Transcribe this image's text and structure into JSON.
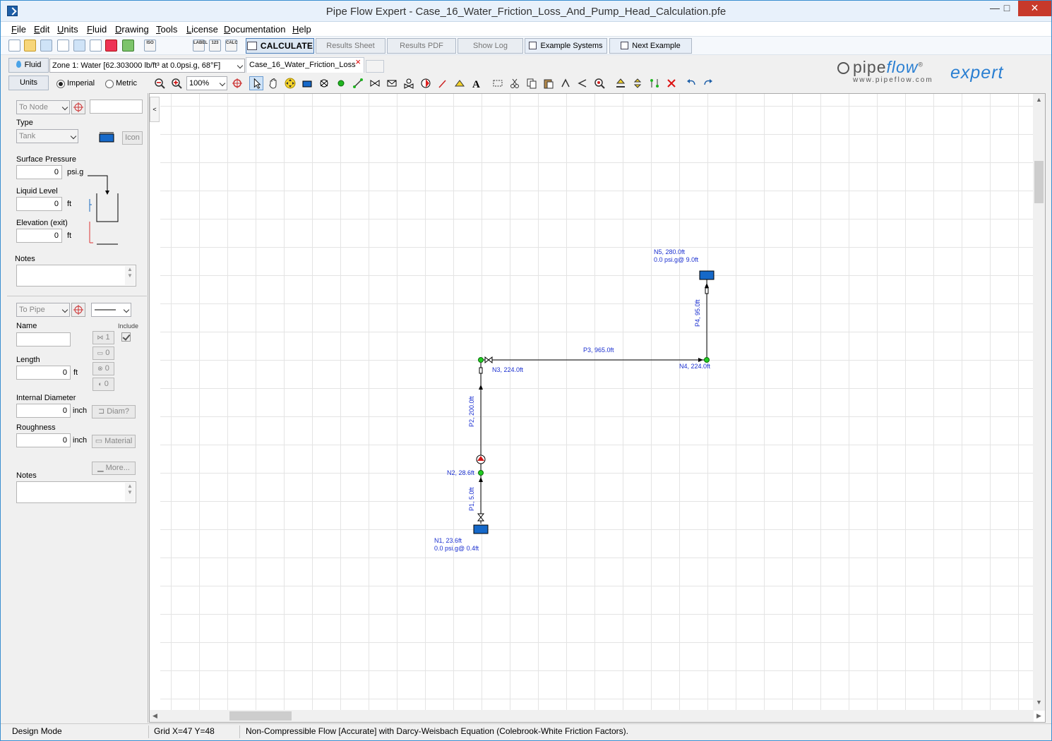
{
  "window": {
    "title": "Pipe Flow Expert - Case_16_Water_Friction_Loss_And_Pump_Head_Calculation.pfe",
    "minimize": "—",
    "maximize": "□",
    "close": "✕"
  },
  "menu": [
    "File",
    "Edit",
    "Units",
    "Fluid",
    "Drawing",
    "Tools",
    "License",
    "Documentation",
    "Help"
  ],
  "toolbar": {
    "calculate": "CALCULATE",
    "results_sheet": "Results Sheet",
    "results_pdf": "Results PDF",
    "show_log": "Show Log",
    "example_systems": "Example Systems",
    "next_example": "Next Example",
    "small_icon_texts": [
      "ISO",
      "LABEL",
      "123",
      "CALC"
    ]
  },
  "fluid_row": {
    "fluid_button": "Fluid",
    "zone": "Zone 1: Water [62.303000 lb/ft³ at 0.0psi.g, 68°F]",
    "tab_name": "Case_16_Water_Friction_Loss",
    "tab_close": "×"
  },
  "units_row": {
    "units_button": "Units",
    "imperial": "Imperial",
    "metric": "Metric",
    "zoom": "100%"
  },
  "logo": {
    "pipe": "pipe",
    "flow": "flow",
    "registered": "®",
    "expert": "expert",
    "url": "www.pipeflow.com"
  },
  "node_panel": {
    "selector": "To Node",
    "type_label": "Type",
    "type_value": "Tank",
    "icon_button": "Icon",
    "surface_pressure_label": "Surface Pressure",
    "surface_pressure_value": "0",
    "surface_pressure_unit": "psi.g",
    "liquid_level_label": "Liquid Level",
    "liquid_level_value": "0",
    "liquid_level_unit": "ft",
    "elevation_label": "Elevation (exit)",
    "elevation_value": "0",
    "elevation_unit": "ft",
    "notes_label": "Notes"
  },
  "pipe_panel": {
    "selector": "To Pipe",
    "name_label": "Name",
    "include_label": "Include",
    "fittings_count": "1",
    "component_count": "0",
    "control_count": "0",
    "pump_count": "0",
    "length_label": "Length",
    "length_value": "0",
    "length_unit": "ft",
    "diameter_label": "Internal Diameter",
    "diameter_value": "0",
    "diameter_unit": "inch",
    "diameter_button": "Diam?",
    "roughness_label": "Roughness",
    "roughness_value": "0",
    "roughness_unit": "inch",
    "material_button": "Material",
    "more_button": "More...",
    "notes_label": "Notes"
  },
  "network": {
    "nodes": {
      "n1_line1": "N1, 23.6ft",
      "n1_line2": "0.0 psi.g@ 0.4ft",
      "n2": "N2, 28.6ft",
      "n3": "N3, 224.0ft",
      "n4": "N4, 224.0ft",
      "n5_line1": "N5, 280.0ft",
      "n5_line2": "0.0 psi.g@ 9.0ft"
    },
    "pipes": {
      "p1": "P1, 5.0ft",
      "p2": "P2, 200.0ft",
      "p3": "P3, 965.0ft",
      "p4": "P4, 95.0ft"
    }
  },
  "canvas": {
    "collapse": "<"
  },
  "status": {
    "mode": "Design Mode",
    "grid": "Grid  X=47  Y=48",
    "method": "Non-Compressible Flow [Accurate] with Darcy-Weisbach Equation (Colebrook-White Friction Factors)."
  }
}
